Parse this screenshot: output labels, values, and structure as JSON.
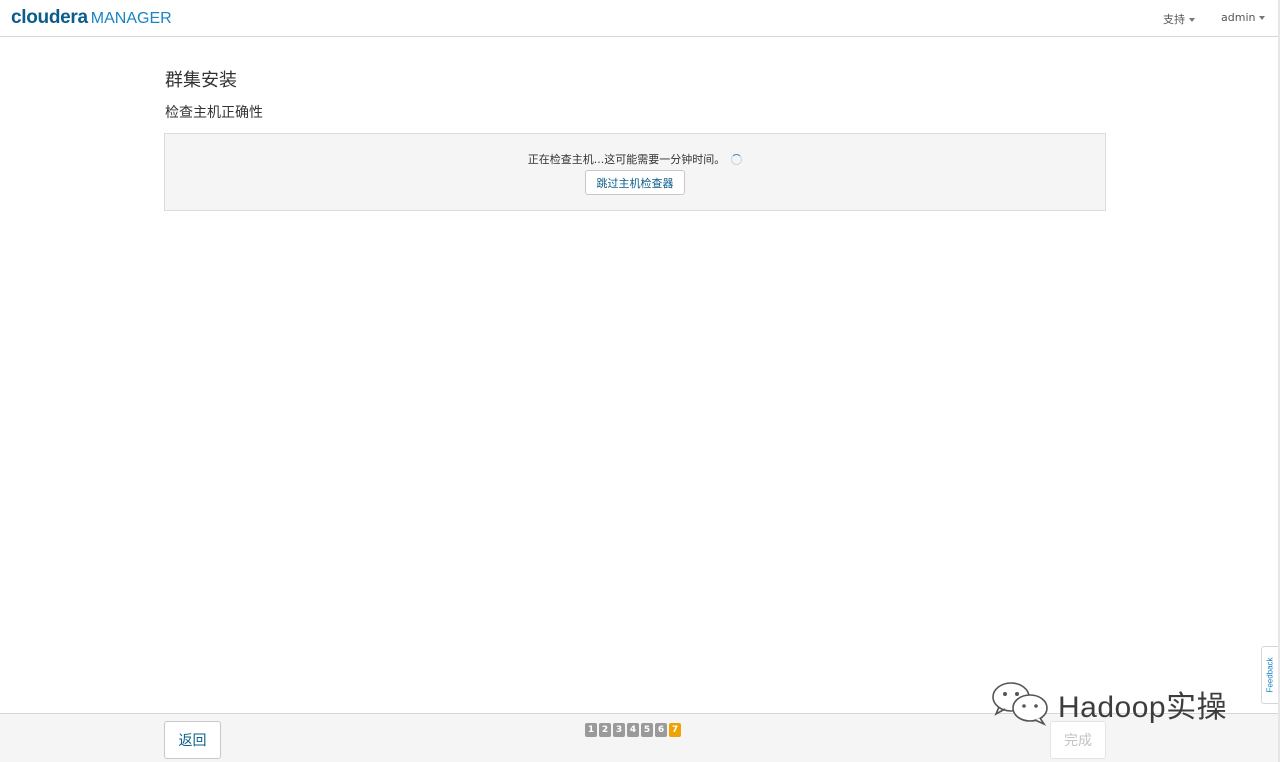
{
  "navbar": {
    "brand": {
      "cloudera": "cloudera",
      "manager": "MANAGER"
    },
    "menus": {
      "support": "支持",
      "user": "admin"
    }
  },
  "page": {
    "title": "群集安装",
    "subtitle": "检查主机正确性",
    "status_message": "正在检查主机...这可能需要一分钟时间。",
    "skip_button": "跳过主机检查器"
  },
  "footer": {
    "back_button": "返回",
    "finish_button": "完成",
    "steps": [
      "1",
      "2",
      "3",
      "4",
      "5",
      "6",
      "7"
    ],
    "current_step": 7
  },
  "feedback_tab": "Feedback",
  "watermark": "Hadoop实操",
  "colors": {
    "brand_dark": "#0a5d8a",
    "brand_light": "#1a84c5",
    "step_active": "#f0a300",
    "step_inactive": "#9a9a9a"
  }
}
